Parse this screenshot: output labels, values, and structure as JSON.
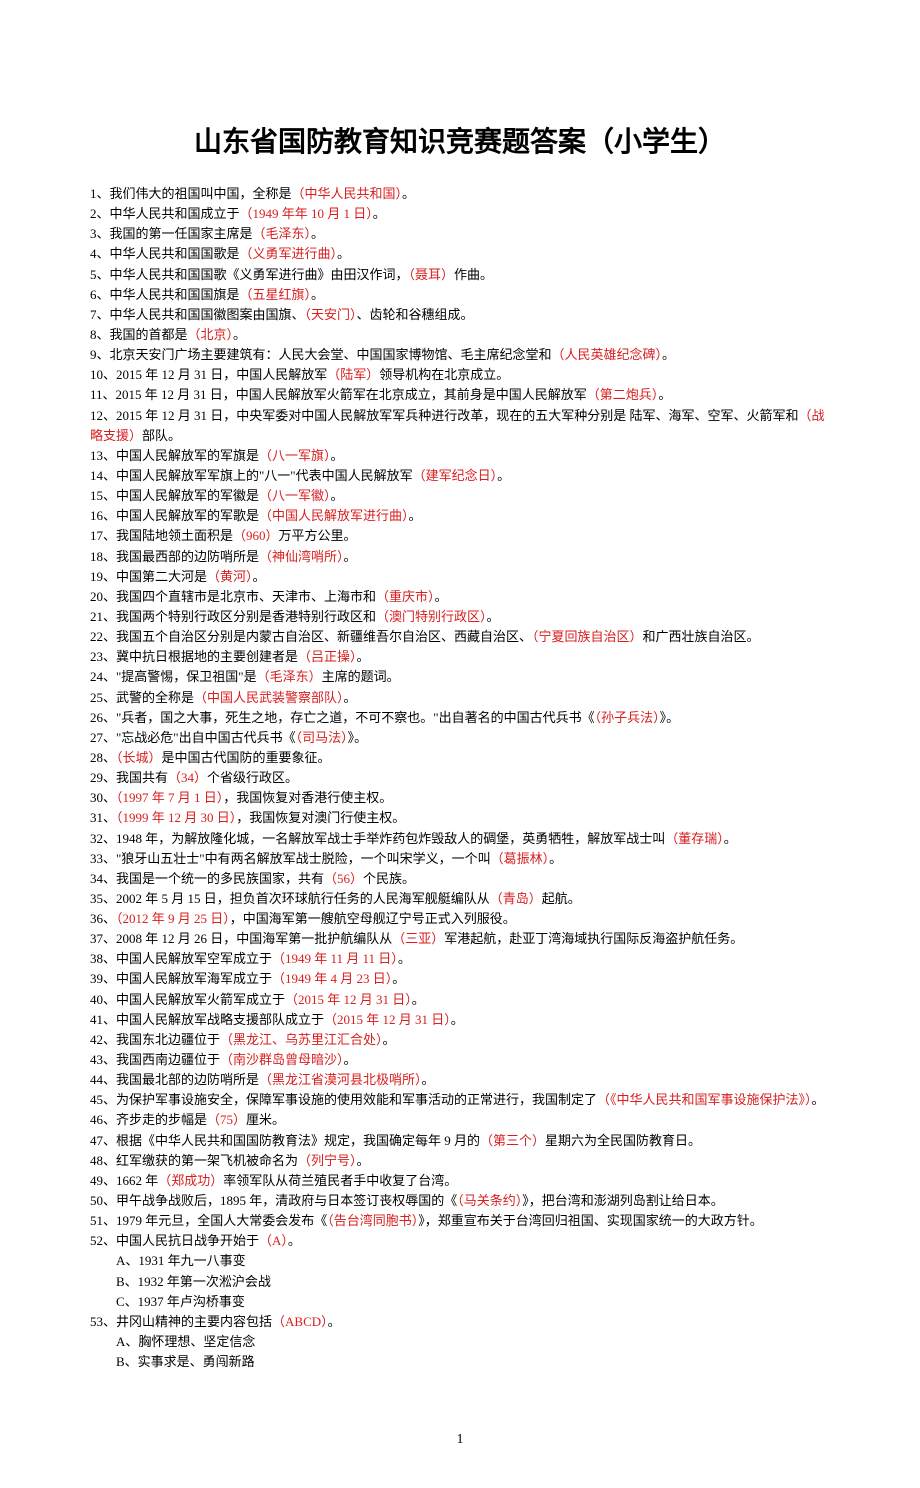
{
  "title": "山东省国防教育知识竞赛题答案（小学生）",
  "items": [
    {
      "n": "1",
      "pre": "、我们伟大的祖国叫中国，全称是",
      "ans": "（中华人民共和国）",
      "post": "。"
    },
    {
      "n": "2",
      "pre": "、中华人民共和国成立于",
      "ans": "（1949 年年 10 月 1 日）",
      "post": "。"
    },
    {
      "n": "3",
      "pre": "、我国的第一任国家主席是",
      "ans": "（毛泽东）",
      "post": "。"
    },
    {
      "n": "4",
      "pre": "、中华人民共和国国歌是",
      "ans": "（义勇军进行曲）",
      "post": "。"
    },
    {
      "n": "5",
      "pre": "、中华人民共和国国歌《义勇军进行曲》由田汉作词，",
      "ans": "（聂耳）",
      "post": "作曲。"
    },
    {
      "n": "6",
      "pre": "、中华人民共和国国旗是",
      "ans": "（五星红旗）",
      "post": "。"
    },
    {
      "n": "7",
      "pre": "、中华人民共和国国徽图案由国旗、",
      "ans": "（天安门）",
      "post": "、齿轮和谷穗组成。"
    },
    {
      "n": "8",
      "pre": "、我国的首都是",
      "ans": "（北京）",
      "post": "。"
    },
    {
      "n": "9",
      "pre": "、北京天安门广场主要建筑有：人民大会堂、中国国家博物馆、毛主席纪念堂和",
      "ans": "（人民英雄纪念碑）",
      "post": "。"
    },
    {
      "n": "10",
      "pre": "、2015 年 12 月 31 日，中国人民解放军",
      "ans": "（陆军）",
      "post": "领导机构在北京成立。"
    },
    {
      "n": "11",
      "pre": "、2015 年 12 月 31 日，中国人民解放军火箭军在北京成立，其前身是中国人民解放军",
      "ans": "（第二炮兵）",
      "post": "。"
    },
    {
      "n": "12",
      "pre": "、2015 年 12 月 31 日，中央军委对中国人民解放军军兵种进行改革，现在的五大军种分别是  陆军、海军、空军、火箭军和",
      "ans": "（战略支援）",
      "post": "部队。"
    },
    {
      "n": "13",
      "pre": "、中国人民解放军的军旗是",
      "ans": "（八一军旗）",
      "post": "。"
    },
    {
      "n": "14",
      "pre": "、中国人民解放军军旗上的\"八一\"代表中国人民解放军",
      "ans": "（建军纪念日）",
      "post": "。"
    },
    {
      "n": "15",
      "pre": "、中国人民解放军的军徽是",
      "ans": "（八一军徽）",
      "post": "。"
    },
    {
      "n": "16",
      "pre": "、中国人民解放军的军歌是",
      "ans": "（中国人民解放军进行曲）",
      "post": "。"
    },
    {
      "n": "17",
      "pre": "、我国陆地领土面积是",
      "ans": "（960）",
      "post": "万平方公里。"
    },
    {
      "n": "18",
      "pre": "、我国最西部的边防哨所是",
      "ans": "（神仙湾哨所）",
      "post": "。"
    },
    {
      "n": "19",
      "pre": "、中国第二大河是",
      "ans": "（黄河）",
      "post": "。"
    },
    {
      "n": "20",
      "pre": "、我国四个直辖市是北京市、天津市、上海市和",
      "ans": "（重庆市）",
      "post": "。"
    },
    {
      "n": "21",
      "pre": "、我国两个特别行政区分别是香港特别行政区和",
      "ans": "（澳门特别行政区）",
      "post": "。"
    },
    {
      "n": "22",
      "pre": "、我国五个自治区分别是内蒙古自治区、新疆维吾尔自治区、西藏自治区、",
      "ans": "（宁夏回族自治区）",
      "post": "和广西壮族自治区。"
    },
    {
      "n": "23",
      "pre": "、冀中抗日根据地的主要创建者是",
      "ans": "（吕正操）",
      "post": "。"
    },
    {
      "n": "24",
      "pre": "、\"提高警惕，保卫祖国\"是",
      "ans": "（毛泽东）",
      "post": "主席的题词。"
    },
    {
      "n": "25",
      "pre": "、武警的全称是",
      "ans": "（中国人民武装警察部队）",
      "post": "。"
    },
    {
      "n": "26",
      "pre": "、\"兵者，国之大事，死生之地，存亡之道，不可不察也。\"出自著名的中国古代兵书《",
      "ans": "（孙子兵法）",
      "post": "》。"
    },
    {
      "n": "27",
      "pre": "、\"忘战必危\"出自中国古代兵书《",
      "ans": "（司马法）",
      "post": "》。"
    },
    {
      "n": "28",
      "pre": "、",
      "ans": "（长城）",
      "post": "是中国古代国防的重要象征。"
    },
    {
      "n": "29",
      "pre": "、我国共有",
      "ans": "（34）",
      "post": "个省级行政区。"
    },
    {
      "n": "30",
      "pre": "、",
      "ans": "（1997 年 7 月 1 日）",
      "post": "，我国恢复对香港行使主权。"
    },
    {
      "n": "31",
      "pre": "、",
      "ans": "（1999 年 12 月 30 日）",
      "post": "，我国恢复对澳门行使主权。"
    },
    {
      "n": "32",
      "pre": "、1948 年，为解放隆化城，一名解放军战士手举炸药包炸毁敌人的碉堡，英勇牺牲，解放军战士叫",
      "ans": "（董存瑞）",
      "post": "。"
    },
    {
      "n": "33",
      "pre": "、\"狼牙山五壮士\"中有两名解放军战士脱险，一个叫宋学义，一个叫",
      "ans": "（葛振林）",
      "post": "。"
    },
    {
      "n": "34",
      "pre": "、我国是一个统一的多民族国家，共有",
      "ans": "（56）",
      "post": "个民族。"
    },
    {
      "n": "35",
      "pre": "、2002 年 5 月 15 日，担负首次环球航行任务的人民海军舰艇编队从",
      "ans": "（青岛）",
      "post": "起航。"
    },
    {
      "n": "36",
      "pre": "、",
      "ans": "（2012 年 9 月 25 日）",
      "post": "，中国海军第一艘航空母舰辽宁号正式入列服役。"
    },
    {
      "n": "37",
      "pre": "、2008 年 12 月 26 日，中国海军第一批护航编队从",
      "ans": "（三亚）",
      "post": "军港起航，赴亚丁湾海域执行国际反海盗护航任务。"
    },
    {
      "n": "38",
      "pre": "、中国人民解放军空军成立于",
      "ans": "（1949 年 11 月 11 日）",
      "post": "。"
    },
    {
      "n": "39",
      "pre": "、中国人民解放军海军成立于",
      "ans": "（1949 年 4 月 23 日）",
      "post": "。"
    },
    {
      "n": "40",
      "pre": "、中国人民解放军火箭军成立于",
      "ans": "（2015 年 12 月 31 日）",
      "post": "。"
    },
    {
      "n": "41",
      "pre": "、中国人民解放军战略支援部队成立于",
      "ans": "（2015 年 12 月 31 日）",
      "post": "。"
    },
    {
      "n": "42",
      "pre": "、我国东北边疆位于",
      "ans": "（黑龙江、乌苏里江汇合处）",
      "post": "。"
    },
    {
      "n": "43",
      "pre": "、我国西南边疆位于",
      "ans": "（南沙群岛曾母暗沙）",
      "post": "。"
    },
    {
      "n": "44",
      "pre": "、我国最北部的边防哨所是",
      "ans": "（黑龙江省漠河县北极哨所）",
      "post": "。"
    },
    {
      "n": "45",
      "pre": "、为保护军事设施安全，保障军事设施的使用效能和军事活动的正常进行，我国制定了",
      "ans": "（《中华人民共和国军事设施保护法》）",
      "post": "。"
    },
    {
      "n": "46",
      "pre": "、齐步走的步幅是",
      "ans": "（75）",
      "post": "厘米。"
    },
    {
      "n": "47",
      "pre": "、根据《中华人民共和国国防教育法》规定，我国确定每年 9 月的",
      "ans": "（第三个）",
      "post": "星期六为全民国防教育日。"
    },
    {
      "n": "48",
      "pre": "、红军缴获的第一架飞机被命名为",
      "ans": "（列宁号）",
      "post": "。"
    },
    {
      "n": "49",
      "pre": "、1662 年",
      "ans": "（郑成功）",
      "post": "率领军队从荷兰殖民者手中收复了台湾。"
    },
    {
      "n": "50",
      "pre": "、甲午战争战败后，1895 年，清政府与日本签订丧权辱国的《",
      "ans": "（马关条约）",
      "post": "》，把台湾和澎湖列岛割让给日本。"
    },
    {
      "n": "51",
      "pre": "、1979 年元旦，全国人大常委会发布《",
      "ans": "（告台湾同胞书）",
      "post": "》，郑重宣布关于台湾回归祖国、实现国家统一的大政方针。"
    }
  ],
  "q52": {
    "n": "52",
    "pre": "、中国人民抗日战争开始于",
    "ans": "（A）",
    "post": "。",
    "opts": [
      "A、1931 年九一八事变",
      "B、1932 年第一次淞沪会战",
      "C、1937 年卢沟桥事变"
    ]
  },
  "q53": {
    "n": "53",
    "pre": "、井冈山精神的主要内容包括",
    "ans": "（ABCD）",
    "post": "。",
    "opts": [
      "A、胸怀理想、坚定信念",
      "B、实事求是、勇闯新路"
    ]
  },
  "page_no": "1"
}
